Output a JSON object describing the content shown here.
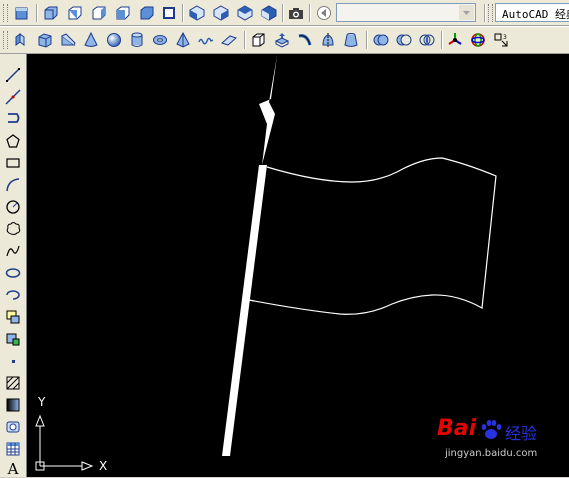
{
  "toolbar_top": {
    "view_combo_value": "",
    "workspace_combo_value": "AutoCAD 经典",
    "icons": [
      "top-view-icon",
      "bottom-view-icon",
      "left-view-icon",
      "right-view-icon",
      "front-view-icon",
      "back-view-icon",
      "sw-iso-icon",
      "se-iso-icon",
      "ne-iso-icon",
      "nw-iso-icon",
      "camera-icon",
      "previous-view-icon"
    ]
  },
  "toolbar_modeling": {
    "icons": [
      "polysolid-icon",
      "box-icon",
      "wedge-icon",
      "cone-icon",
      "sphere-icon",
      "cylinder-icon",
      "torus-icon",
      "pyramid-icon",
      "helix-icon",
      "planar-surface-icon",
      "extrude-icon",
      "presspull-icon",
      "sweep-icon",
      "revolve-icon",
      "loft-icon",
      "union-icon",
      "subtract-icon",
      "intersect-icon",
      "3d-move-icon",
      "3d-rotate-icon",
      "3d-align-icon"
    ]
  },
  "draw_toolbar": {
    "icons": [
      "line-icon",
      "construction-line-icon",
      "polyline-icon",
      "polygon-icon",
      "rectangle-icon",
      "arc-icon",
      "circle-icon",
      "revision-cloud-icon",
      "spline-icon",
      "ellipse-icon",
      "ellipse-arc-icon",
      "insert-block-icon",
      "make-block-icon",
      "point-icon",
      "hatch-icon",
      "gradient-icon",
      "region-icon",
      "table-icon",
      "multiline-text-icon"
    ],
    "text_tool_label": "A"
  },
  "drawing": {
    "ucs_x_label": "X",
    "ucs_y_label": "Y",
    "background": "#000000",
    "stroke": "#ffffff"
  },
  "watermark": {
    "brand": "Bai",
    "brand_suffix": "经验",
    "url": "jingyan.baidu.com",
    "red": "#e10602",
    "blue": "#2932e1"
  }
}
